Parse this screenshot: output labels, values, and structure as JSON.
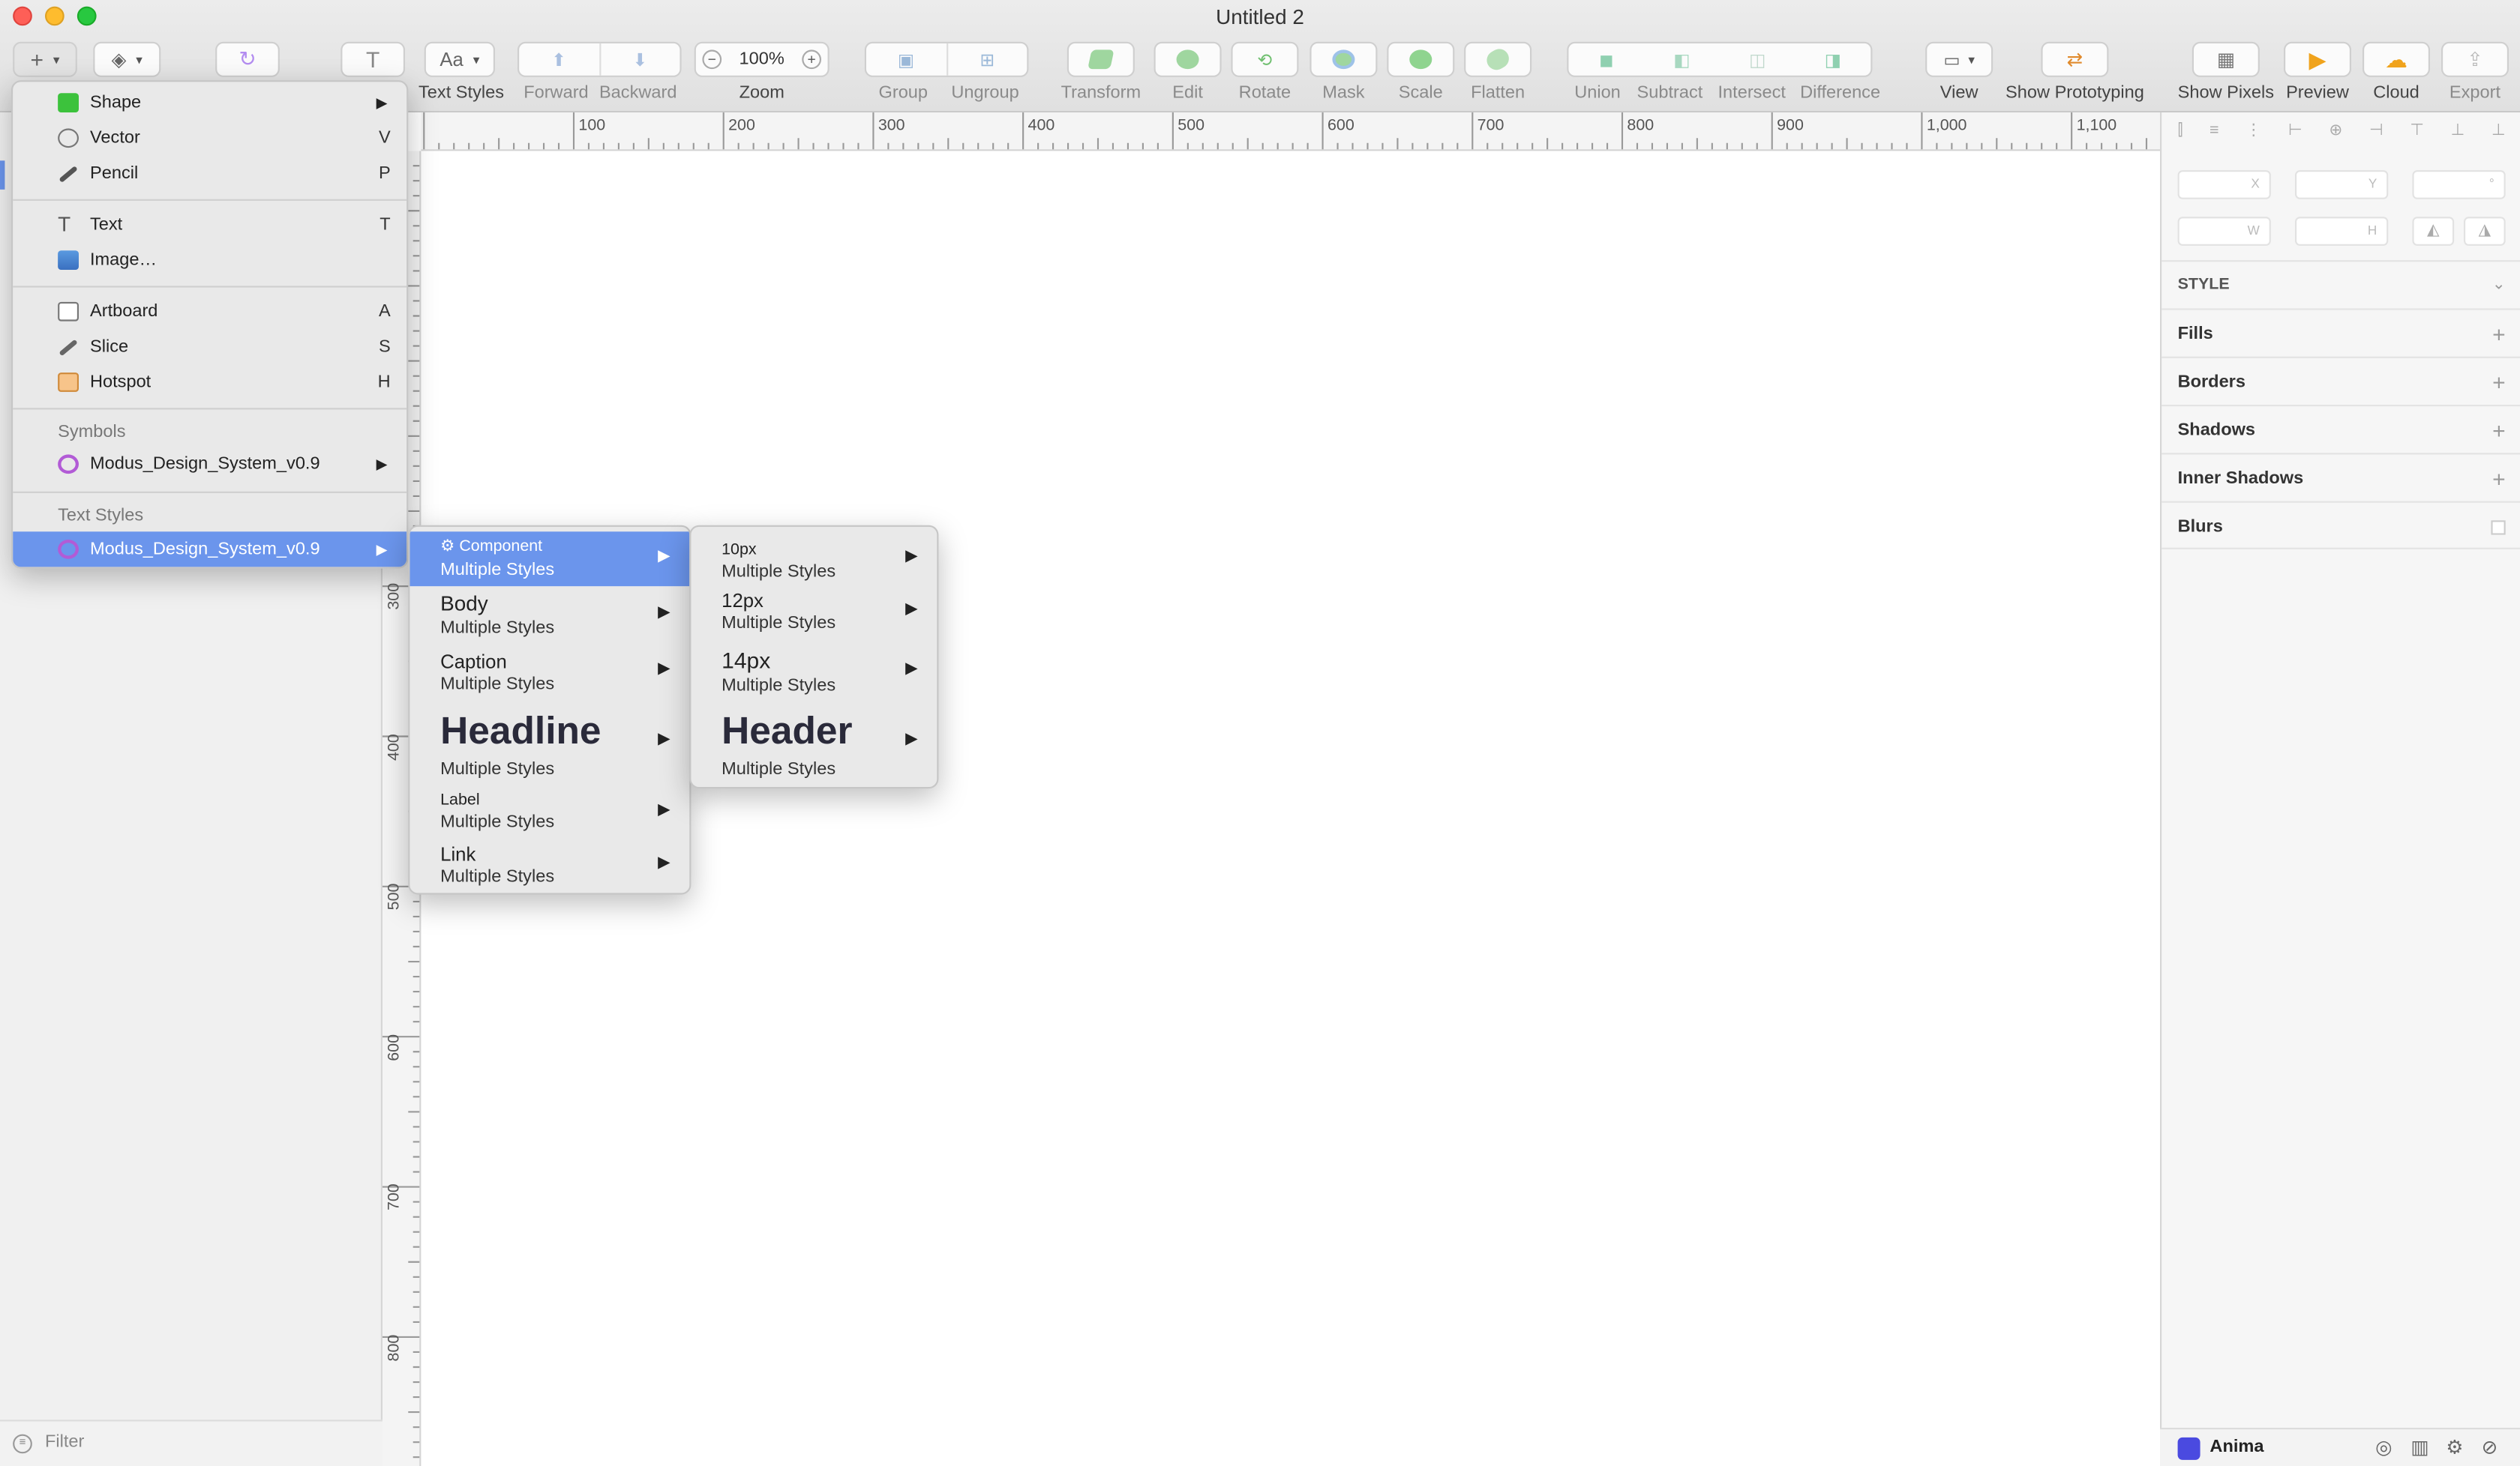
{
  "window": {
    "title": "Untitled 2"
  },
  "toolbar": {
    "text_styles_label": "Text Styles",
    "forward_label": "Forward",
    "backward_label": "Backward",
    "zoom_label": "Zoom",
    "zoom_value": "100%",
    "group_label": "Group",
    "ungroup_label": "Ungroup",
    "transform_label": "Transform",
    "edit_label": "Edit",
    "rotate_label": "Rotate",
    "mask_label": "Mask",
    "scale_label": "Scale",
    "flatten_label": "Flatten",
    "union_label": "Union",
    "subtract_label": "Subtract",
    "intersect_label": "Intersect",
    "difference_label": "Difference",
    "view_label": "View",
    "show_prototyping_label": "Show Prototyping",
    "show_pixels_label": "Show Pixels",
    "preview_label": "Preview",
    "cloud_label": "Cloud",
    "export_label": "Export",
    "text_style_button": "Aa",
    "text_tool_glyph": "T"
  },
  "ruler": {
    "horizontal": [
      "100",
      "200",
      "300",
      "400",
      "500",
      "600",
      "700",
      "800",
      "900",
      "1,000",
      "1,100"
    ],
    "vertical": [
      "300",
      "400",
      "500",
      "600",
      "700",
      "800"
    ]
  },
  "insert_menu": {
    "items": [
      {
        "label": "Shape",
        "shortcut": "▶"
      },
      {
        "label": "Vector",
        "shortcut": "V"
      },
      {
        "label": "Pencil",
        "shortcut": "P"
      },
      {
        "label": "Text",
        "shortcut": "T"
      },
      {
        "label": "Image…",
        "shortcut": ""
      },
      {
        "label": "Artboard",
        "shortcut": "A"
      },
      {
        "label": "Slice",
        "shortcut": "S"
      },
      {
        "label": "Hotspot",
        "shortcut": "H"
      }
    ],
    "symbols_header": "Symbols",
    "symbols_item": "Modus_Design_System_v0.9",
    "text_styles_header": "Text Styles",
    "text_styles_item": "Modus_Design_System_v0.9"
  },
  "styles_submenu": {
    "items": [
      {
        "title": "Component",
        "subtitle": "Multiple Styles"
      },
      {
        "title": "Body",
        "subtitle": "Multiple Styles"
      },
      {
        "title": "Caption",
        "subtitle": "Multiple Styles"
      },
      {
        "title": "Headline",
        "subtitle": "Multiple Styles"
      },
      {
        "title": "Label",
        "subtitle": "Multiple Styles"
      },
      {
        "title": "Link",
        "subtitle": "Multiple Styles"
      }
    ]
  },
  "component_submenu": {
    "items": [
      {
        "title": "10px",
        "subtitle": "Multiple Styles"
      },
      {
        "title": "12px",
        "subtitle": "Multiple Styles"
      },
      {
        "title": "14px",
        "subtitle": "Multiple Styles"
      },
      {
        "title": "Header",
        "subtitle": "Multiple Styles"
      }
    ]
  },
  "inspector": {
    "fields": {
      "x": "X",
      "y": "Y",
      "rotation": "°",
      "w": "W",
      "h": "H"
    },
    "style_header": "STYLE",
    "sections": [
      "Fills",
      "Borders",
      "Shadows",
      "Inner Shadows",
      "Blurs"
    ]
  },
  "sidebar": {
    "filter_placeholder": "Filter"
  },
  "bottom_bar": {
    "anima_label": "Anima"
  },
  "colors": {
    "highlight": "#6b95ec",
    "shape_icon": "#3cc23c",
    "symbol_icon": "#b25bd6"
  }
}
